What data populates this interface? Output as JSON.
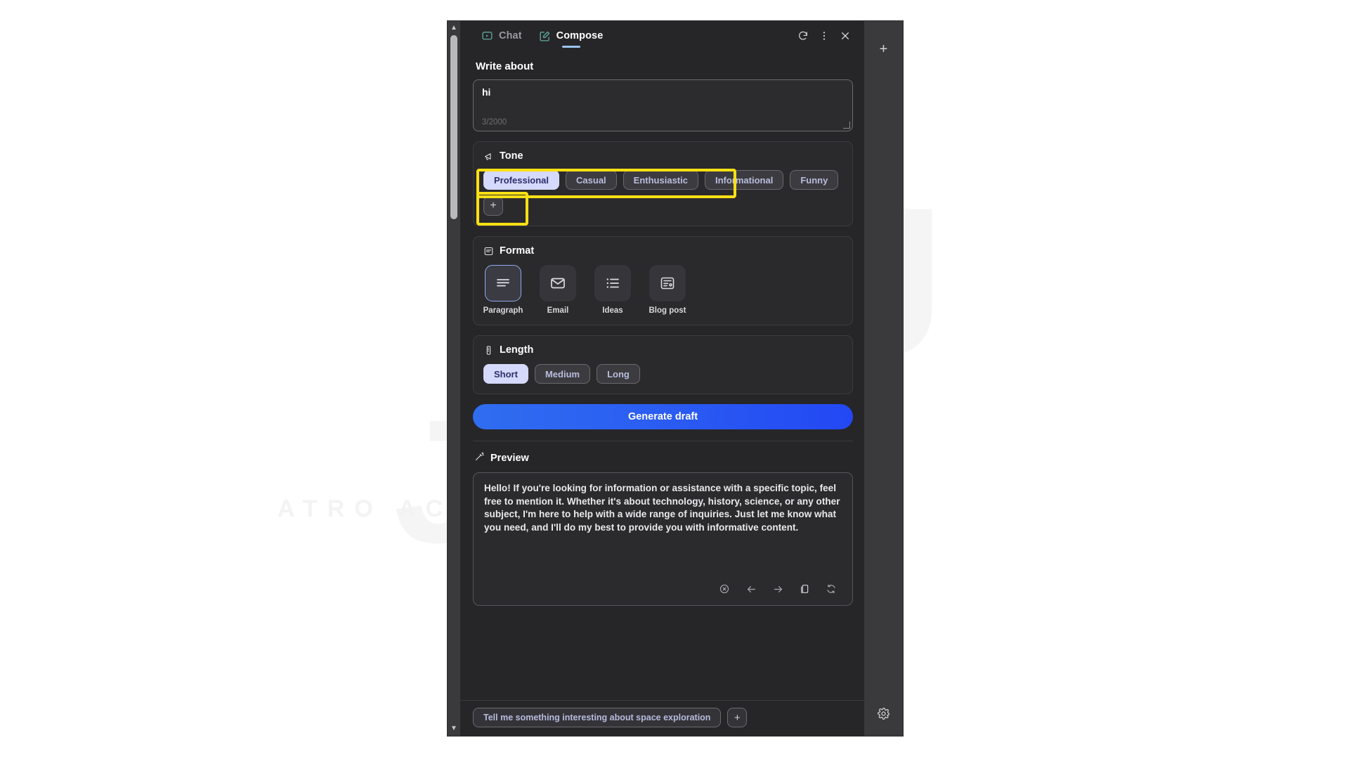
{
  "watermark": {
    "brand": "ATRO ACADEMY"
  },
  "window": {
    "tabs": [
      {
        "id": "chat",
        "label": "Chat",
        "icon": "chat-bubble-icon",
        "active": false
      },
      {
        "id": "compose",
        "label": "Compose",
        "icon": "compose-pencil-icon",
        "active": true
      }
    ],
    "controls": [
      {
        "id": "refresh",
        "icon": "refresh-icon"
      },
      {
        "id": "more",
        "icon": "more-vertical-icon"
      },
      {
        "id": "close",
        "icon": "close-icon"
      }
    ]
  },
  "write_about": {
    "label": "Write about",
    "value": "hi",
    "placeholder": "Write about",
    "counter": "3/2000"
  },
  "tone": {
    "label": "Tone",
    "icon": "tone-megaphone-icon",
    "chips": [
      {
        "label": "Professional",
        "selected": true
      },
      {
        "label": "Casual",
        "selected": false
      },
      {
        "label": "Enthusiastic",
        "selected": false
      },
      {
        "label": "Informational",
        "selected": false
      },
      {
        "label": "Funny",
        "selected": false
      }
    ],
    "add_label": "+",
    "highlight_color": "#ffe014"
  },
  "format": {
    "label": "Format",
    "icon": "format-document-icon",
    "items": [
      {
        "label": "Paragraph",
        "icon": "paragraph-lines-icon",
        "selected": true
      },
      {
        "label": "Email",
        "icon": "envelope-icon",
        "selected": false
      },
      {
        "label": "Ideas",
        "icon": "bullet-list-icon",
        "selected": false
      },
      {
        "label": "Blog post",
        "icon": "blog-post-icon",
        "selected": false
      }
    ]
  },
  "length": {
    "label": "Length",
    "icon": "length-ruler-icon",
    "chips": [
      {
        "label": "Short",
        "selected": true
      },
      {
        "label": "Medium",
        "selected": false
      },
      {
        "label": "Long",
        "selected": false
      }
    ]
  },
  "generate": {
    "label": "Generate draft",
    "accent": "#2b5ef2"
  },
  "preview": {
    "label": "Preview",
    "icon": "magic-wand-icon",
    "text": "Hello! If you're looking for information or assistance with a specific topic, feel free to mention it. Whether it's about technology, history, science, or any other subject, I'm here to help with a wide range of inquiries. Just let me know what you need, and I'll do my best to provide you with informative content.",
    "actions": [
      {
        "id": "dismiss",
        "icon": "close-circle-icon"
      },
      {
        "id": "previous",
        "icon": "arrow-left-icon"
      },
      {
        "id": "next",
        "icon": "arrow-right-icon"
      },
      {
        "id": "copy",
        "icon": "copy-icon"
      },
      {
        "id": "regenerate",
        "icon": "regenerate-icon"
      }
    ]
  },
  "bottom_bar": {
    "suggestion": "Tell me something interesting about space exploration",
    "add_label": "+"
  },
  "rail": {
    "add_label": "+",
    "gear_icon": "settings-gear-icon"
  }
}
